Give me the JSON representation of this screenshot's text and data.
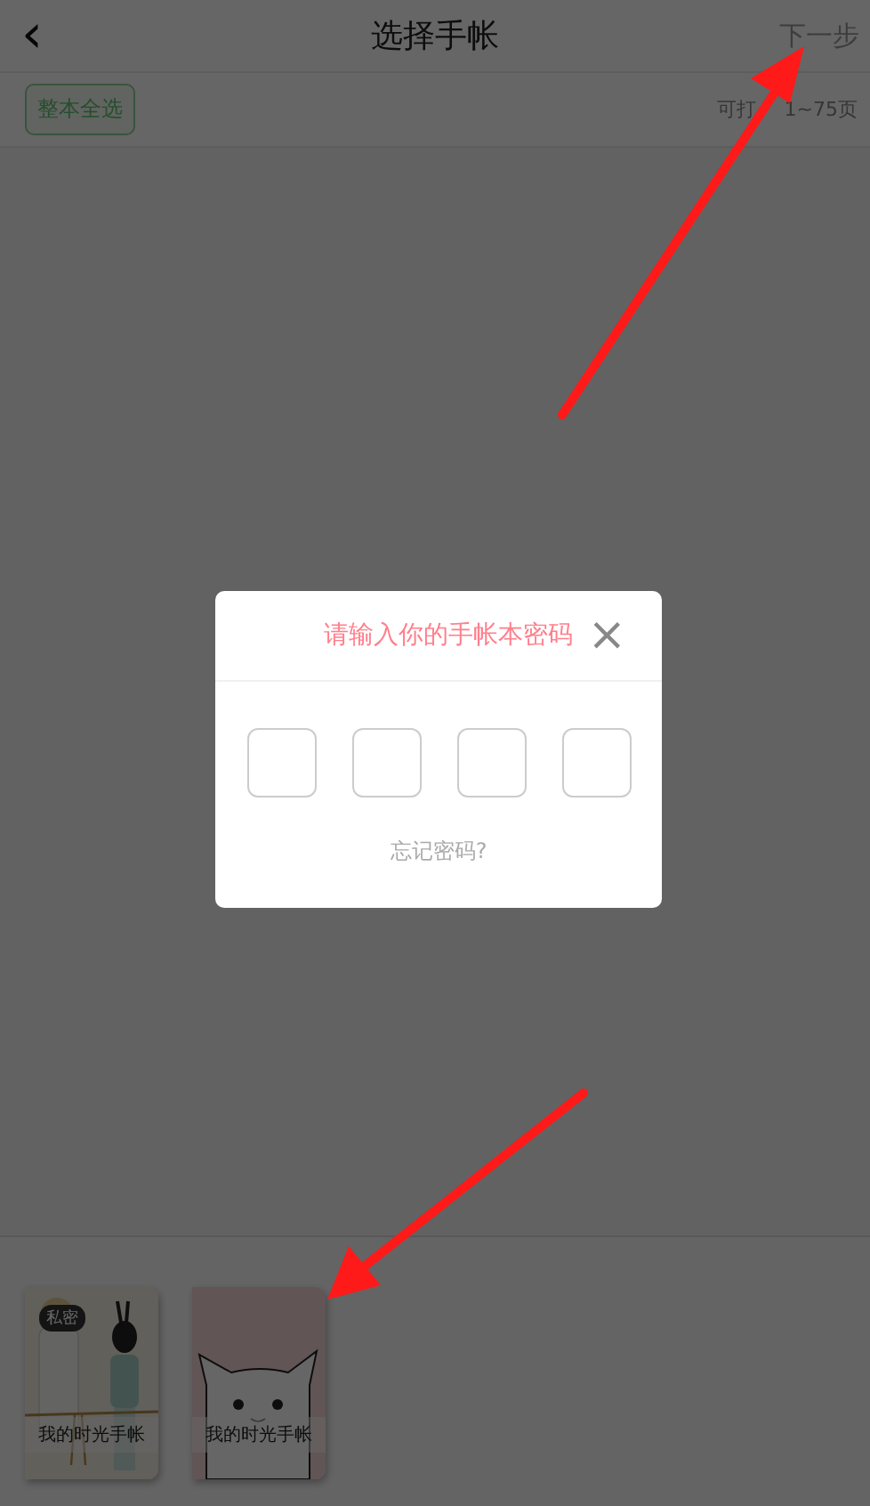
{
  "nav": {
    "back": "‹",
    "title": "选择手帐",
    "next": "下一步"
  },
  "toolbar": {
    "select_all": "整本全选",
    "page_range_start": "可打",
    "page_range_end": "1~75页"
  },
  "notebooks": [
    {
      "title": "我的时光手帐",
      "badge": "私密",
      "kind": "couple"
    },
    {
      "title": "我的时光手帐",
      "kind": "cat"
    }
  ],
  "dialog": {
    "title": "请输入你的手帐本密码",
    "close": "×",
    "forgot": "忘记密码?"
  }
}
